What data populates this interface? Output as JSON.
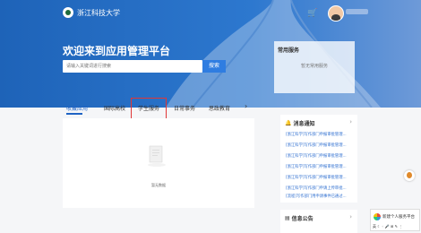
{
  "header": {
    "logo_text": "浙江科技大学",
    "welcome": "欢迎来到应用管理平台",
    "search_placeholder": "请输入关键词进行搜索",
    "search_button": "搜索"
  },
  "common_services": {
    "title": "常用服务",
    "empty": "暂无常用服务"
  },
  "tabs": [
    {
      "label": "收藏应用"
    },
    {
      "label": "国际高校"
    },
    {
      "label": "学生服务"
    },
    {
      "label": "日常事务"
    },
    {
      "label": "思政教育"
    }
  ],
  "main": {
    "empty_text": "暂无数据"
  },
  "notice": {
    "title": "消息通知",
    "more": "›",
    "items": [
      "[浙江科学]写作部门申报审批管理...",
      "[浙江科学]写作部门申报审批管理...",
      "[浙江科学]写作部门申报审批管理...",
      "[浙江科学]写作部门申报审批管理...",
      "[浙江科学]写作部门申报审批管理...",
      "[浙江科学]写作部门申请上传审批...",
      "[流程]写作部门用申请事件已通过..."
    ]
  },
  "announcement": {
    "title": "信息公告",
    "more": "›"
  },
  "chat_widget": {
    "title": "新建个人服务平台",
    "tools": "英 ☾ ◦ 🎤 ⊞ ✎ ⋮"
  },
  "colors": {
    "primary": "#1f63c4",
    "header_start": "#1e63b8",
    "highlight_border": "#e03636"
  }
}
